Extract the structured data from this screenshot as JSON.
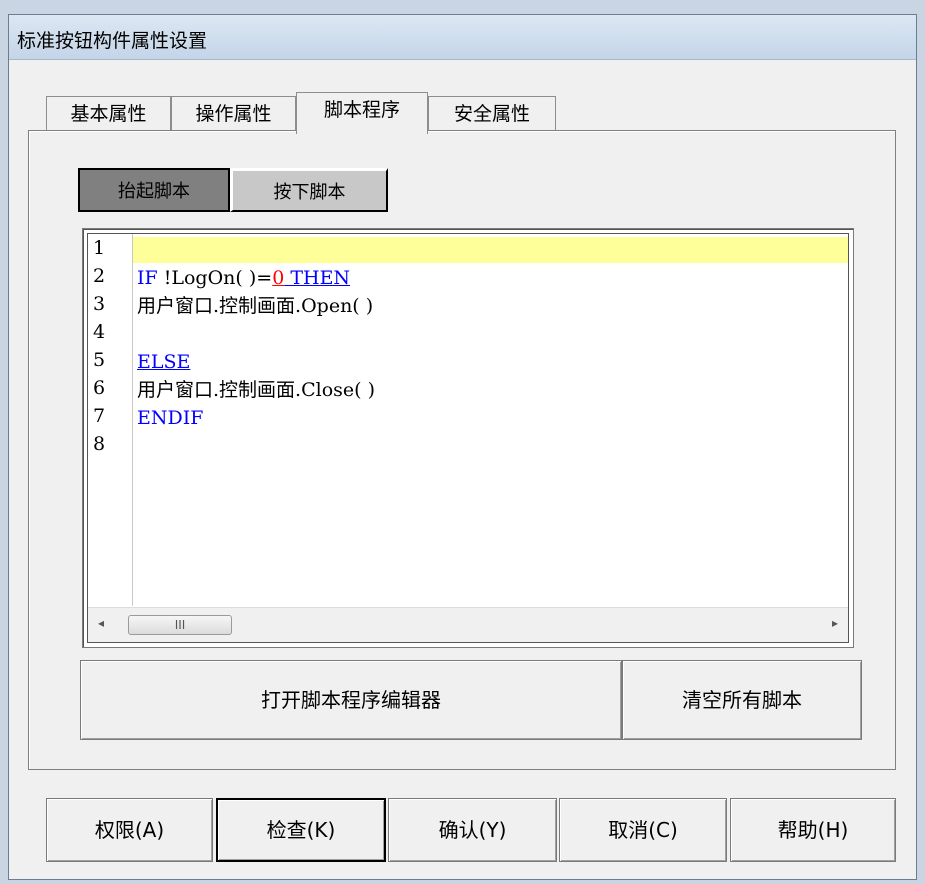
{
  "window": {
    "title": "标准按钮构件属性设置"
  },
  "tabs": [
    {
      "label": "基本属性",
      "active": false
    },
    {
      "label": "操作属性",
      "active": false
    },
    {
      "label": "脚本程序",
      "active": true
    },
    {
      "label": "安全属性",
      "active": false
    }
  ],
  "subtabs": [
    {
      "label": "抬起脚本",
      "active": true
    },
    {
      "label": "按下脚本",
      "active": false
    }
  ],
  "editor": {
    "line_numbers": [
      "1",
      "2",
      "3",
      "4",
      "5",
      "6",
      "7",
      "8"
    ],
    "lines": {
      "l1": "",
      "l2_kw_if": "IF ",
      "l2_fn": "!LogOn( )=",
      "l2_num": "0",
      "l2_kw_then": " THEN",
      "l3": "用户窗口.控制画面.Open( )",
      "l4": "",
      "l5_kw": "ELSE",
      "l6": "用户窗口.控制画面.Close( )",
      "l7_kw": "ENDIF",
      "l8": ""
    },
    "scrollbar": {
      "left_arrow": "◂",
      "thumb_grip": "III",
      "right_arrow": "▸"
    },
    "colors": {
      "current_line": "#ffff99",
      "keyword": "#0000ff",
      "number": "#ff0000"
    }
  },
  "actions": {
    "open_editor": "打开脚本程序编辑器",
    "clear_scripts": "清空所有脚本"
  },
  "footer": {
    "permission": "权限(A)",
    "check": "检查(K)",
    "confirm": "确认(Y)",
    "cancel": "取消(C)",
    "help": "帮助(H)"
  }
}
